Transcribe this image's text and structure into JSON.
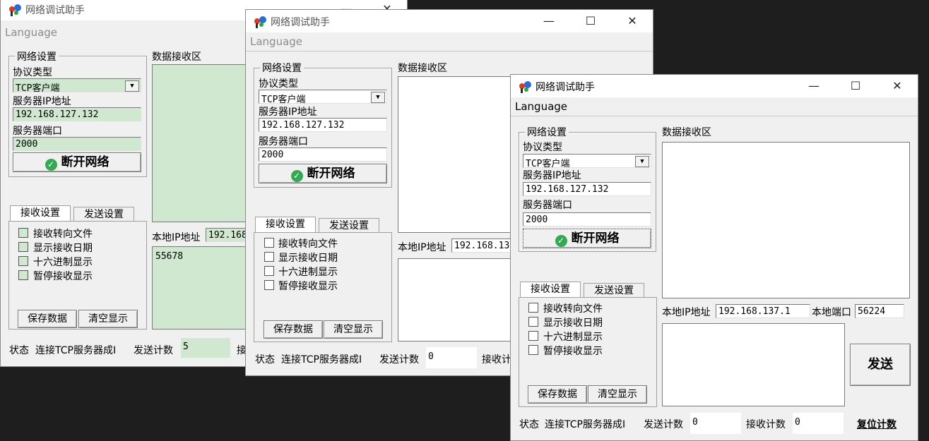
{
  "app": {
    "title": "网络调试助手",
    "menu_language": "Language",
    "minimize_icon": "minimize-icon",
    "maximize_icon": "maximize-icon",
    "close_icon": "close-icon"
  },
  "labels": {
    "network_settings": "网络设置",
    "protocol_type": "协议类型",
    "server_ip": "服务器IP地址",
    "server_port": "服务器端口",
    "receive_area": "数据接收区",
    "disconnect": "断开网络",
    "tab_receive": "接收设置",
    "tab_send": "发送设置",
    "cb_file": "接收转向文件",
    "cb_date": "显示接收日期",
    "cb_hex": "十六进制显示",
    "cb_pause": "暂停接收显示",
    "save_data": "保存数据",
    "clear_display": "清空显示",
    "local_ip": "本地IP地址",
    "local_port": "本地端口",
    "send": "发送",
    "status": "状态",
    "status_text": "连接TCP服务器成I",
    "send_count": "发送计数",
    "recv_count": "接收计数",
    "recv_count_short": "接",
    "reset_count": "复位计数"
  },
  "window1": {
    "protocol": "TCP客户端",
    "server_ip": "192.168.127.132",
    "server_port": "2000",
    "local_ip_partial": "192.168",
    "send_text": "55678",
    "send_count": "5",
    "colors": {
      "field_bg": "#cfe8cf"
    }
  },
  "window2": {
    "protocol": "TCP客户端",
    "server_ip": "192.168.127.132",
    "server_port": "2000",
    "local_ip_partial": "192.168.13",
    "send_count": "0",
    "recv_count_short": "接收计"
  },
  "window3": {
    "protocol": "TCP客户端",
    "server_ip": "192.168.127.132",
    "server_port": "2000",
    "local_ip": "192.168.137.1",
    "local_port": "56224",
    "send_count": "0",
    "recv_count": "0"
  },
  "icons": {
    "app": "app-logo-icon",
    "check": "green-check-icon",
    "combo": "dropdown-arrow-icon"
  }
}
